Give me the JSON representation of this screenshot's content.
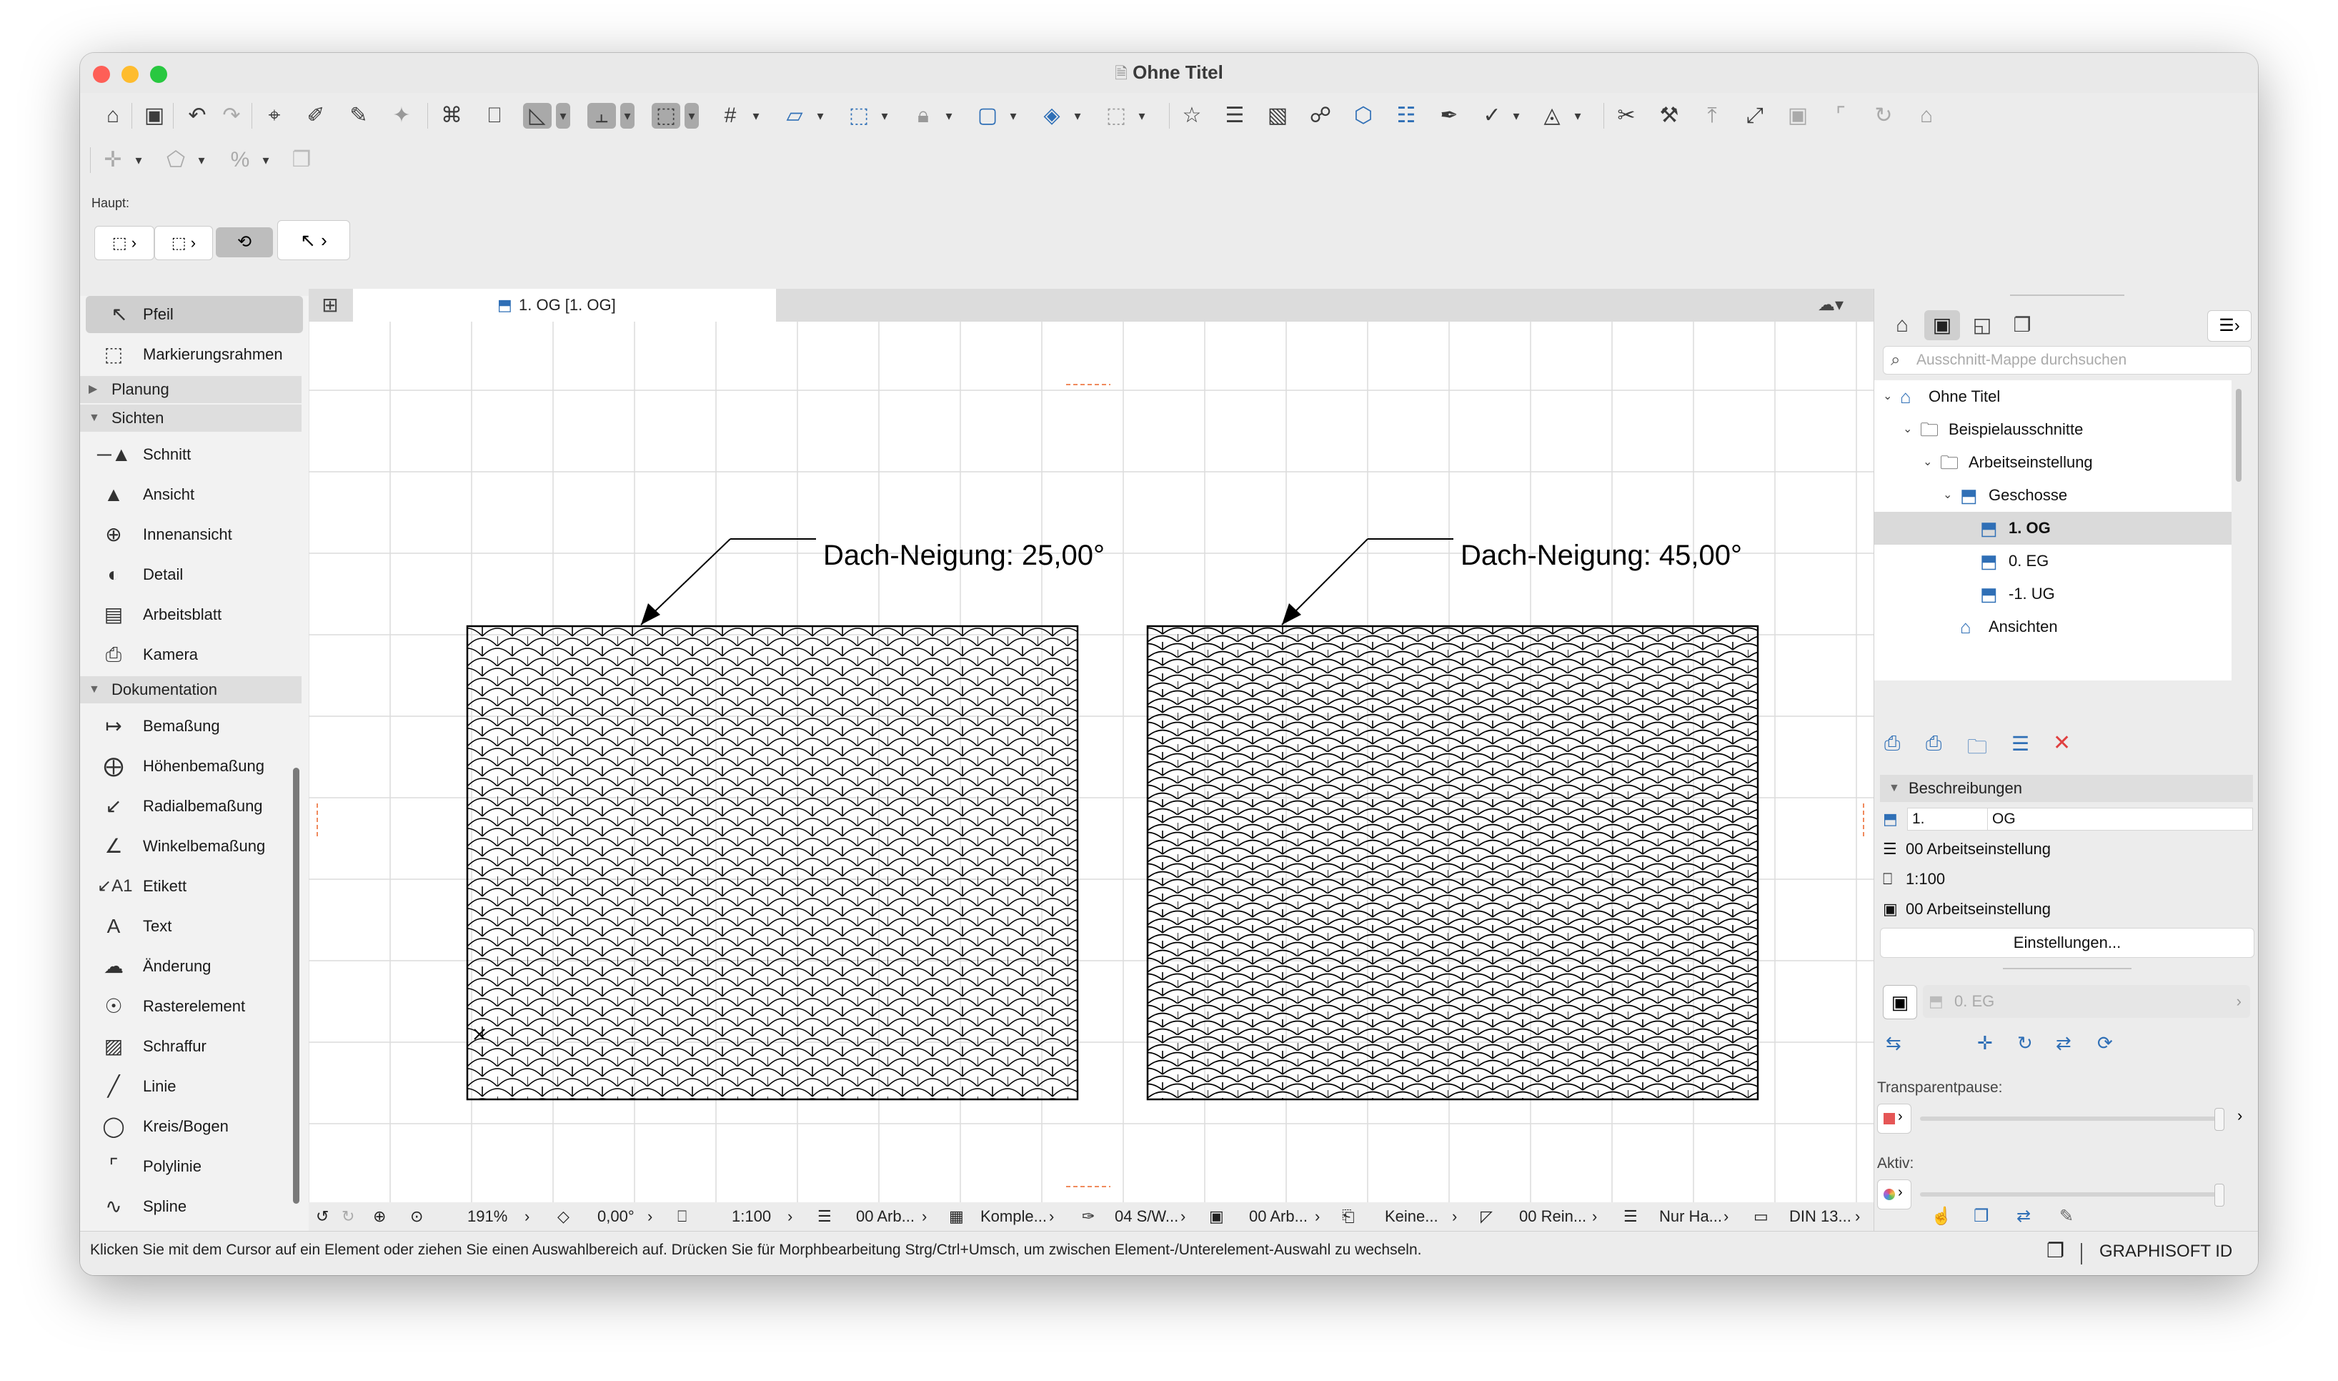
{
  "window": {
    "title": "Ohne Titel",
    "colors": {
      "close": "#fe5f57",
      "minimize": "#febc2e",
      "zoom": "#28c840",
      "accent_red": "#e04040"
    }
  },
  "toolbar": {
    "haupt_label": "Haupt:"
  },
  "toolbox": {
    "selection": [
      {
        "label": "Pfeil",
        "icon": "arrow-icon",
        "active": true
      },
      {
        "label": "Markierungsrahmen",
        "icon": "marquee-icon",
        "active": false
      }
    ],
    "sections": [
      {
        "label": "Planung"
      },
      {
        "label": "Sichten"
      },
      {
        "label": "Dokumentation"
      }
    ],
    "sichten_items": [
      {
        "label": "Schnitt",
        "icon": "section-icon"
      },
      {
        "label": "Ansicht",
        "icon": "elevation-icon"
      },
      {
        "label": "Innenansicht",
        "icon": "interior-elevation-icon"
      },
      {
        "label": "Detail",
        "icon": "detail-icon"
      },
      {
        "label": "Arbeitsblatt",
        "icon": "worksheet-icon"
      },
      {
        "label": "Kamera",
        "icon": "camera-icon"
      }
    ],
    "doku_items": [
      {
        "label": "Bemaßung",
        "icon": "dimension-icon"
      },
      {
        "label": "Höhenbemaßung",
        "icon": "level-dimension-icon"
      },
      {
        "label": "Radialbemaßung",
        "icon": "radial-dimension-icon"
      },
      {
        "label": "Winkelbemaßung",
        "icon": "angle-dimension-icon"
      },
      {
        "label": "Etikett",
        "icon": "label-icon"
      },
      {
        "label": "Text",
        "icon": "text-icon"
      },
      {
        "label": "Änderung",
        "icon": "change-icon"
      },
      {
        "label": "Rasterelement",
        "icon": "grid-element-icon"
      },
      {
        "label": "Schraffur",
        "icon": "fill-icon"
      },
      {
        "label": "Linie",
        "icon": "line-icon"
      },
      {
        "label": "Kreis/Bogen",
        "icon": "arc-icon"
      },
      {
        "label": "Polylinie",
        "icon": "polyline-icon"
      },
      {
        "label": "Spline",
        "icon": "spline-icon"
      }
    ]
  },
  "tab": {
    "label": "1. OG [1. OG]"
  },
  "canvas": {
    "label_left": "Dach-Neigung: 25,00°",
    "label_right": "Dach-Neigung: 45,00°"
  },
  "statusbar": {
    "zoom": "191%",
    "angle": "0,00°",
    "scale": "1:100",
    "layer": "00 Arb...",
    "complexity": "Komple...",
    "pen": "04 S/W...",
    "view": "00 Arb...",
    "override": "Keine...",
    "renovation": "00 Rein...",
    "structure": "Nur Ha...",
    "paper": "DIN 13..."
  },
  "bottom": {
    "hint": "Klicken Sie mit dem Cursor auf ein Element oder ziehen Sie einen Auswahlbereich auf. Drücken Sie für Morphbearbeitung Strg/Ctrl+Umsch, um zwischen Element-/Unterelement-Auswahl zu wechseln.",
    "graphisoft": "GRAPHISOFT ID"
  },
  "navigator": {
    "search_placeholder": "Ausschnitt-Mappe durchsuchen",
    "tree": [
      {
        "label": "Ohne Titel",
        "level": 0,
        "icon": "project-icon",
        "selected": false
      },
      {
        "label": "Beispielausschnitte",
        "level": 1,
        "icon": "folder-icon",
        "selected": false
      },
      {
        "label": "Arbeitseinstellung",
        "level": 2,
        "icon": "folder-icon",
        "selected": false
      },
      {
        "label": "Geschosse",
        "level": 3,
        "icon": "stories-icon",
        "selected": false
      },
      {
        "label": "1. OG",
        "level": 4,
        "icon": "story-icon",
        "selected": true
      },
      {
        "label": "0. EG",
        "level": 4,
        "icon": "story-icon",
        "selected": false
      },
      {
        "label": "-1. UG",
        "level": 4,
        "icon": "story-icon",
        "selected": false
      },
      {
        "label": "Ansichten",
        "level": 3,
        "icon": "elevations-icon",
        "selected": false
      }
    ],
    "desc_header": "Beschreibungen",
    "desc_id": "1.",
    "desc_name": "OG",
    "desc_rows": [
      {
        "label": "00 Arbeitseinstellung",
        "icon": "layers-icon"
      },
      {
        "label": "1:100",
        "icon": "scale-icon"
      },
      {
        "label": "00 Arbeitseinstellung",
        "icon": "model-view-icon"
      }
    ],
    "settings_button": "Einstellungen...",
    "trace_ref": "0. EG",
    "transparency_label": "Transparentpause:",
    "active_label": "Aktiv:"
  }
}
